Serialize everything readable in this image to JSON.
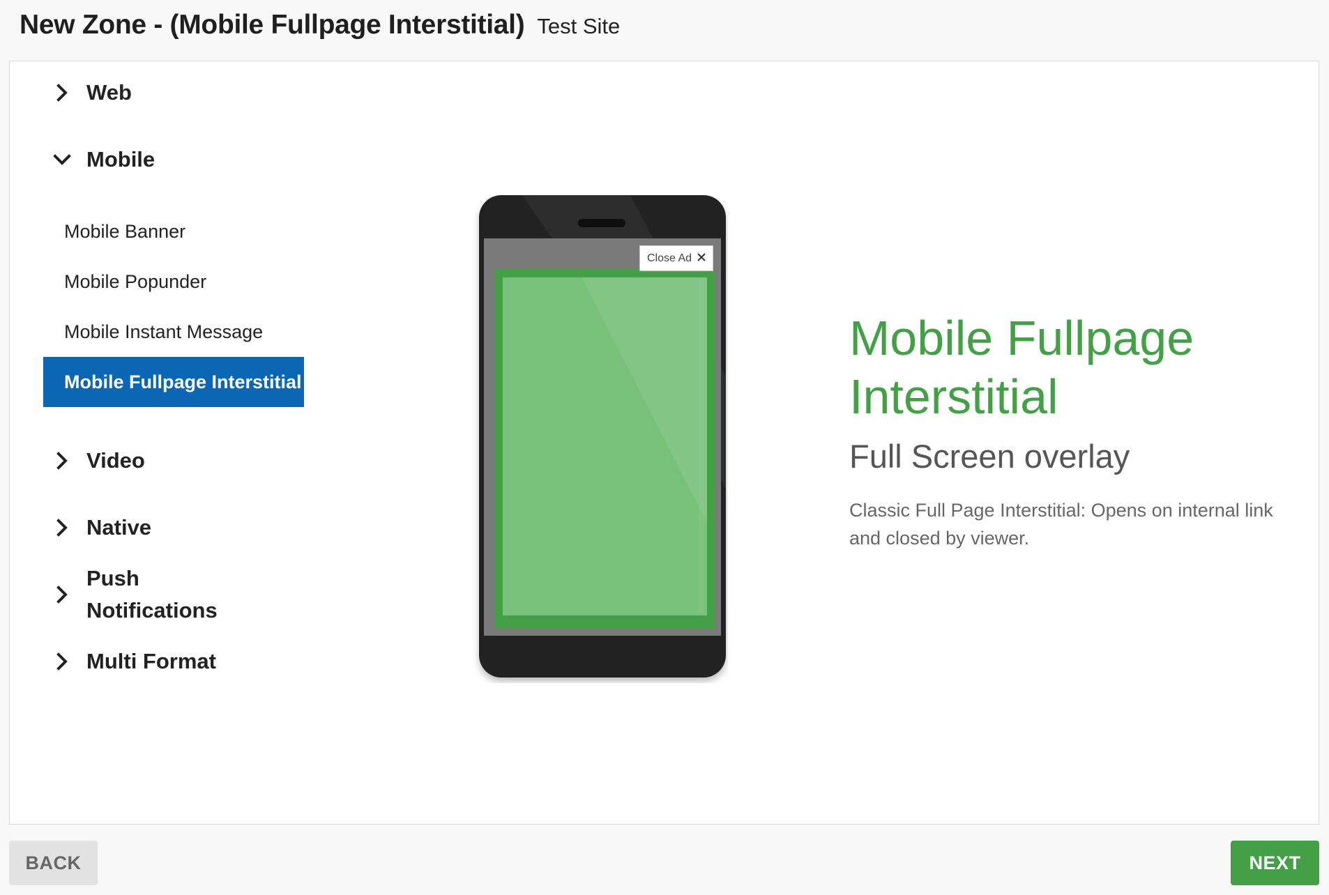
{
  "header": {
    "title": "New Zone - (Mobile Fullpage Interstitial)",
    "site": "Test Site"
  },
  "nav": {
    "categories": [
      {
        "label": "Web",
        "expanded": false
      },
      {
        "label": "Mobile",
        "expanded": true
      },
      {
        "label": "Video",
        "expanded": false
      },
      {
        "label": "Native",
        "expanded": false
      },
      {
        "label": "Push Notifications",
        "expanded": false
      },
      {
        "label": "Multi Format",
        "expanded": false
      }
    ],
    "mobile_items": [
      {
        "label": "Mobile Banner",
        "selected": false
      },
      {
        "label": "Mobile Popunder",
        "selected": false
      },
      {
        "label": "Mobile Instant Message",
        "selected": false
      },
      {
        "label": "Mobile Fullpage Interstitial",
        "selected": true
      }
    ]
  },
  "preview": {
    "close_ad_label": "Close Ad"
  },
  "info": {
    "name_line1": "Mobile Fullpage",
    "name_line2": "Interstitial",
    "subtitle": "Full Screen overlay",
    "description": "Classic Full Page Interstitial: Opens on internal link and closed by viewer."
  },
  "footer": {
    "back_label": "BACK",
    "next_label": "NEXT"
  },
  "colors": {
    "accent_green": "#43a047",
    "selected_blue": "#0b67b4"
  }
}
